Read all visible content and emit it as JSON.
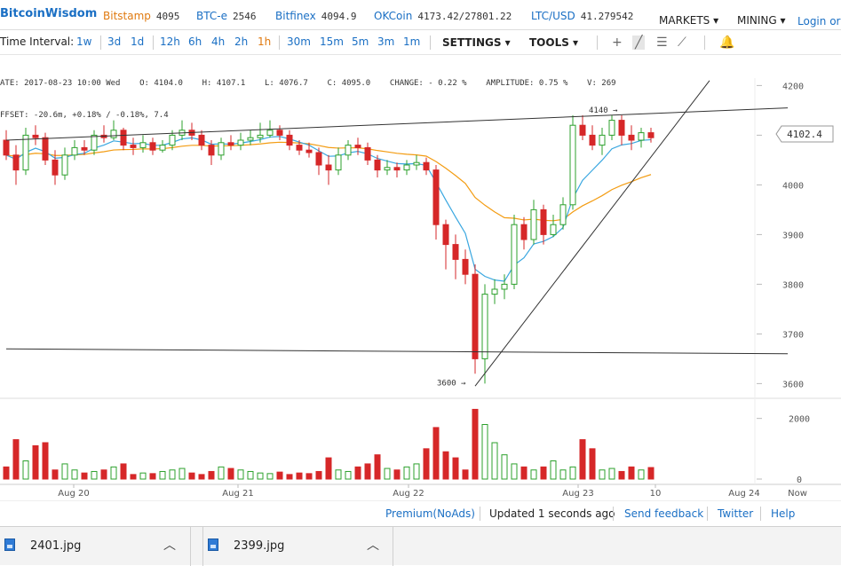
{
  "header": {
    "logo": "BitcoinWisdom",
    "exchanges": [
      {
        "name": "Bitstamp",
        "value": "4095"
      },
      {
        "name": "BTC-e",
        "value": "2546"
      },
      {
        "name": "Bitfinex",
        "value": "4094.9"
      },
      {
        "name": "OKCoin",
        "value": "4173.42/27801.22"
      },
      {
        "name": "LTC/USD",
        "value": "41.279542"
      }
    ],
    "menus": [
      "MARKETS ▾",
      "MINING ▾"
    ],
    "login": "Login or"
  },
  "toolbar": {
    "time_interval_label": "Time Interval:",
    "intervals": [
      "1w",
      "3d",
      "1d",
      "12h",
      "6h",
      "4h",
      "2h",
      "1h",
      "30m",
      "15m",
      "5m",
      "3m",
      "1m"
    ],
    "active_interval": "1h",
    "settings_label": "SETTINGS ▾",
    "tools_label": "TOOLS ▾"
  },
  "info": {
    "line1": "ATE: 2017-08-23 10:00 Wed    O: 4104.0    H: 4107.1    L: 4076.7    C: 4095.0    CHANGE: - 0.22 %    AMPLITUDE: 0.75 %    V: 269",
    "line2": "FFSET: -20.6m, +0.18% / -0.18%, 7.4"
  },
  "chart_data": {
    "type": "candlestick",
    "price_axis_ticks": [
      4200,
      4100,
      4000,
      3900,
      3800,
      3700,
      3600
    ],
    "volume_axis_ticks": [
      2000,
      0
    ],
    "ylim": [
      3590,
      4215
    ],
    "current_price": "4102.4",
    "annotations": [
      {
        "label": "4140 →",
        "value": 4140
      },
      {
        "label": "3600 →",
        "value": 3600
      }
    ],
    "x_labels": [
      "Aug 20",
      "Aug 21",
      "Aug 22",
      "Aug 23",
      "10",
      "Aug 24",
      "Now"
    ],
    "candles": [
      [
        4090,
        4060,
        4110,
        4050
      ],
      [
        4060,
        4030,
        4080,
        4000
      ],
      [
        4030,
        4100,
        4115,
        4020
      ],
      [
        4100,
        4095,
        4120,
        4080
      ],
      [
        4095,
        4050,
        4105,
        4040
      ],
      [
        4050,
        4020,
        4070,
        4000
      ],
      [
        4020,
        4060,
        4075,
        4010
      ],
      [
        4060,
        4075,
        4090,
        4050
      ],
      [
        4075,
        4070,
        4090,
        4060
      ],
      [
        4070,
        4100,
        4110,
        4060
      ],
      [
        4100,
        4095,
        4120,
        4085
      ],
      [
        4095,
        4110,
        4130,
        4090
      ],
      [
        4110,
        4080,
        4115,
        4070
      ],
      [
        4080,
        4075,
        4095,
        4060
      ],
      [
        4075,
        4085,
        4100,
        4065
      ],
      [
        4085,
        4070,
        4095,
        4060
      ],
      [
        4070,
        4080,
        4090,
        4065
      ],
      [
        4080,
        4100,
        4110,
        4070
      ],
      [
        4100,
        4110,
        4130,
        4090
      ],
      [
        4110,
        4100,
        4125,
        4090
      ],
      [
        4100,
        4080,
        4110,
        4070
      ],
      [
        4080,
        4060,
        4090,
        4040
      ],
      [
        4060,
        4085,
        4095,
        4050
      ],
      [
        4085,
        4080,
        4100,
        4070
      ],
      [
        4080,
        4090,
        4105,
        4070
      ],
      [
        4090,
        4095,
        4110,
        4080
      ],
      [
        4095,
        4100,
        4125,
        4085
      ],
      [
        4100,
        4110,
        4130,
        4095
      ],
      [
        4110,
        4100,
        4120,
        4090
      ],
      [
        4100,
        4080,
        4110,
        4070
      ],
      [
        4080,
        4070,
        4090,
        4060
      ],
      [
        4070,
        4065,
        4085,
        4055
      ],
      [
        4065,
        4040,
        4075,
        4020
      ],
      [
        4040,
        4030,
        4060,
        4000
      ],
      [
        4030,
        4060,
        4075,
        4020
      ],
      [
        4060,
        4080,
        4090,
        4050
      ],
      [
        4080,
        4075,
        4095,
        4060
      ],
      [
        4075,
        4050,
        4085,
        4040
      ],
      [
        4050,
        4030,
        4060,
        4015
      ],
      [
        4030,
        4035,
        4050,
        4020
      ],
      [
        4035,
        4030,
        4045,
        4015
      ],
      [
        4030,
        4040,
        4050,
        4020
      ],
      [
        4040,
        4045,
        4060,
        4030
      ],
      [
        4045,
        4030,
        4055,
        4020
      ],
      [
        4030,
        3920,
        4040,
        3890
      ],
      [
        3920,
        3880,
        3930,
        3830
      ],
      [
        3880,
        3850,
        3900,
        3810
      ],
      [
        3850,
        3820,
        3870,
        3800
      ],
      [
        3820,
        3650,
        3840,
        3620
      ],
      [
        3650,
        3780,
        3800,
        3600
      ],
      [
        3780,
        3790,
        3810,
        3760
      ],
      [
        3790,
        3800,
        3820,
        3770
      ],
      [
        3800,
        3920,
        3940,
        3790
      ],
      [
        3920,
        3890,
        3935,
        3870
      ],
      [
        3890,
        3950,
        3970,
        3880
      ],
      [
        3950,
        3900,
        3960,
        3880
      ],
      [
        3900,
        3920,
        3940,
        3895
      ],
      [
        3920,
        3960,
        3975,
        3910
      ],
      [
        3960,
        4120,
        4140,
        3950
      ],
      [
        4120,
        4100,
        4140,
        4090
      ],
      [
        4100,
        4080,
        4120,
        4070
      ],
      [
        4080,
        4100,
        4115,
        4060
      ],
      [
        4100,
        4130,
        4140,
        4090
      ],
      [
        4130,
        4100,
        4140,
        4080
      ],
      [
        4100,
        4090,
        4120,
        4070
      ],
      [
        4090,
        4105,
        4115,
        4075
      ],
      [
        4105,
        4095,
        4115,
        4085
      ]
    ],
    "volumes": [
      400,
      1300,
      600,
      1100,
      1200,
      300,
      500,
      300,
      200,
      250,
      300,
      400,
      500,
      150,
      200,
      180,
      250,
      300,
      350,
      200,
      150,
      250,
      400,
      350,
      300,
      250,
      200,
      180,
      230,
      150,
      200,
      180,
      250,
      700,
      300,
      250,
      400,
      500,
      800,
      350,
      300,
      400,
      500,
      1000,
      1700,
      900,
      700,
      300,
      2300,
      1800,
      1200,
      800,
      500,
      400,
      300,
      400,
      600,
      300,
      400,
      1300,
      1000,
      300,
      350,
      250,
      400,
      300,
      380
    ],
    "trendlines": [
      {
        "name": "resistance",
        "from": [
          0,
          4090
        ],
        "to": [
          80,
          4155
        ]
      },
      {
        "name": "support-horizontal",
        "from": [
          0,
          3670
        ],
        "to": [
          80,
          3660
        ]
      },
      {
        "name": "rising-support",
        "from": [
          48,
          3595
        ],
        "to": [
          72,
          4210
        ]
      }
    ]
  },
  "footer": {
    "premium": "Premium(NoAds)",
    "updated": "Updated 1 seconds ago",
    "feedback": "Send feedback",
    "twitter": "Twitter",
    "help": "Help"
  },
  "downloads": [
    {
      "name": "2401.jpg"
    },
    {
      "name": "2399.jpg"
    }
  ],
  "colors": {
    "up": "#2ca02c",
    "down": "#d62728",
    "ema1": "#f39c12",
    "ema2": "#3aa7e0"
  }
}
